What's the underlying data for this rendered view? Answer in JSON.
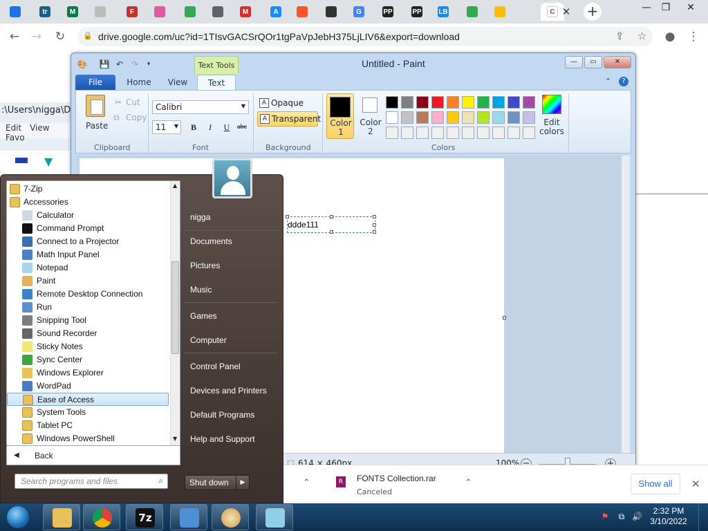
{
  "browser": {
    "tabs": [
      {
        "icon": "gamepad-icon",
        "text": "",
        "color": "#1a73e8"
      },
      {
        "icon": "tr-icon",
        "text": "tr",
        "color": "#1a5f8a"
      },
      {
        "icon": "m-icon",
        "text": "M",
        "color": "#0d7a4a"
      },
      {
        "icon": "scribble-icon",
        "text": "",
        "color": "#bbbbbb"
      },
      {
        "icon": "f-icon",
        "text": "F",
        "color": "#c0322c"
      },
      {
        "icon": "colorwheel-icon",
        "text": "",
        "color": "#e25a9e"
      },
      {
        "icon": "drive-icon",
        "text": "",
        "color": "#34a853"
      },
      {
        "icon": "globe-icon",
        "text": "",
        "color": "#5f6368"
      },
      {
        "icon": "m-red-icon",
        "text": "M",
        "color": "#d93025"
      },
      {
        "icon": "appstore-icon",
        "text": "A",
        "color": "#1a8cff"
      },
      {
        "icon": "brave-icon",
        "text": "",
        "color": "#fb542b"
      },
      {
        "icon": "museum-icon",
        "text": "",
        "color": "#333333"
      },
      {
        "icon": "google-icon",
        "text": "G",
        "color": "#4285f4"
      },
      {
        "icon": "pp-icon",
        "text": "PP",
        "color": "#222222"
      },
      {
        "icon": "pp-icon",
        "text": "PP",
        "color": "#222222"
      },
      {
        "icon": "lb-icon",
        "text": "LB",
        "color": "#1e88e5"
      },
      {
        "icon": "drive-icon",
        "text": "",
        "color": "#34a853"
      },
      {
        "icon": "drive-icon",
        "text": "",
        "color": "#fbbc04"
      },
      {
        "icon": "blank-icon",
        "text": "",
        "color": "#dee1e6"
      },
      {
        "icon": "tab-icon",
        "text": "C",
        "color": "#ffffff"
      }
    ],
    "url": "drive.google.com/uc?id=1TIsvGACSrQOr1tgPaVpJebH375LjLIV6&export=download",
    "new_tab": "+",
    "close_tab": "✕"
  },
  "explorer": {
    "path": ":\\Users\\nigga\\D",
    "menu": [
      "Edit",
      "View",
      "Favo"
    ]
  },
  "paint": {
    "title": "Untitled - Paint",
    "context_tab": "Text Tools",
    "tabs": [
      "File",
      "Home",
      "View",
      "Text"
    ],
    "clipboard": {
      "paste": "Paste",
      "cut": "Cut",
      "copy": "Copy",
      "label": "Clipboard"
    },
    "font": {
      "family": "Calibri",
      "size": "11",
      "bold": "B",
      "italic": "I",
      "underline": "U",
      "strike": "abc",
      "label": "Font"
    },
    "background": {
      "opaque": "Opaque",
      "transparent": "Transparent",
      "label": "Background"
    },
    "colors": {
      "color1": "Color 1",
      "color2": "Color 2",
      "edit": "Edit colors",
      "label": "Colors",
      "row1": [
        "#000000",
        "#7f7f7f",
        "#880015",
        "#ed1c24",
        "#ff7f27",
        "#fff200",
        "#22b14c",
        "#00a2e8",
        "#3f48cc",
        "#a349a4"
      ],
      "row2": [
        "#ffffff",
        "#c3c3c3",
        "#b97a57",
        "#ffaec9",
        "#ffc90e",
        "#efe4b0",
        "#b5e61d",
        "#99d9ea",
        "#7092be",
        "#c8bfe7"
      ],
      "row3": [
        "#f0f0f0",
        "#f0f0f0",
        "#f0f0f0",
        "#f0f0f0",
        "#f0f0f0",
        "#f0f0f0",
        "#f0f0f0",
        "#f0f0f0",
        "#f0f0f0",
        "#f0f0f0"
      ]
    },
    "canvas_text": "ddde111",
    "status": {
      "dimensions": "614 × 460px",
      "zoom": "100%"
    }
  },
  "startmenu": {
    "programs": [
      {
        "label": "7-Zip",
        "icon": "folder-icon",
        "indent": 0
      },
      {
        "label": "Accessories",
        "icon": "folder-icon",
        "indent": 0
      },
      {
        "label": "Calculator",
        "icon": "calculator-icon",
        "indent": 1
      },
      {
        "label": "Command Prompt",
        "icon": "cmd-icon",
        "indent": 1
      },
      {
        "label": "Connect to a Projector",
        "icon": "projector-icon",
        "indent": 1
      },
      {
        "label": "Math Input Panel",
        "icon": "math-icon",
        "indent": 1
      },
      {
        "label": "Notepad",
        "icon": "notepad-icon",
        "indent": 1
      },
      {
        "label": "Paint",
        "icon": "paint-icon",
        "indent": 1
      },
      {
        "label": "Remote Desktop Connection",
        "icon": "remote-desktop-icon",
        "indent": 1
      },
      {
        "label": "Run",
        "icon": "run-icon",
        "indent": 1
      },
      {
        "label": "Snipping Tool",
        "icon": "scissors-icon",
        "indent": 1
      },
      {
        "label": "Sound Recorder",
        "icon": "microphone-icon",
        "indent": 1
      },
      {
        "label": "Sticky Notes",
        "icon": "sticky-note-icon",
        "indent": 1
      },
      {
        "label": "Sync Center",
        "icon": "sync-icon",
        "indent": 1
      },
      {
        "label": "Windows Explorer",
        "icon": "explorer-icon",
        "indent": 1
      },
      {
        "label": "WordPad",
        "icon": "wordpad-icon",
        "indent": 1
      },
      {
        "label": "Ease of Access",
        "icon": "folder-icon",
        "indent": 1,
        "selected": true
      },
      {
        "label": "System Tools",
        "icon": "folder-icon",
        "indent": 1
      },
      {
        "label": "Tablet PC",
        "icon": "folder-icon",
        "indent": 1
      },
      {
        "label": "Windows PowerShell",
        "icon": "folder-icon",
        "indent": 1
      }
    ],
    "back": "Back",
    "search_placeholder": "Search programs and files",
    "right_links": [
      "nigga",
      "Documents",
      "Pictures",
      "Music",
      "Games",
      "Computer",
      "Control Panel",
      "Devices and Printers",
      "Default Programs",
      "Help and Support"
    ],
    "shutdown": "Shut down"
  },
  "downloads": {
    "filename": "FONTS Collection.rar",
    "status": "Canceled",
    "show_all": "Show all"
  },
  "taskbar": {
    "time": "2:32 PM",
    "date": "3/10/2022"
  }
}
